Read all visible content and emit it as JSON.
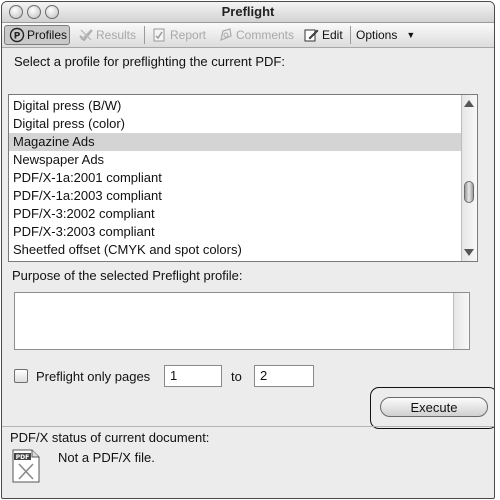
{
  "window": {
    "title": "Preflight"
  },
  "toolbar": {
    "profiles_label": "Profiles",
    "results_label": "Results",
    "report_label": "Report",
    "comments_label": "Comments",
    "edit_label": "Edit",
    "options_label": "Options"
  },
  "profiles": {
    "prompt": "Select a profile for preflighting the current PDF:",
    "items": [
      {
        "label": "Digital press (B/W)"
      },
      {
        "label": "Digital press (color)"
      },
      {
        "label": "Magazine Ads"
      },
      {
        "label": "Newspaper Ads"
      },
      {
        "label": "PDF/X-1a:2001 compliant"
      },
      {
        "label": "PDF/X-1a:2003 compliant"
      },
      {
        "label": "PDF/X-3:2002 compliant"
      },
      {
        "label": "PDF/X-3:2003 compliant"
      },
      {
        "label": "Sheetfed offset (CMYK and spot colors)"
      }
    ],
    "selected_index": 2
  },
  "purpose": {
    "label": "Purpose of the selected Preflight profile:",
    "text": ""
  },
  "pages": {
    "checkbox_label": "Preflight only pages",
    "checked": false,
    "from_value": "1",
    "to_label": "to",
    "to_value": "2"
  },
  "execute": {
    "label": "Execute"
  },
  "pdfx": {
    "status_label": "PDF/X status of current document:",
    "status_text": "Not a PDF/X file.",
    "icon_letters": "PDF"
  }
}
